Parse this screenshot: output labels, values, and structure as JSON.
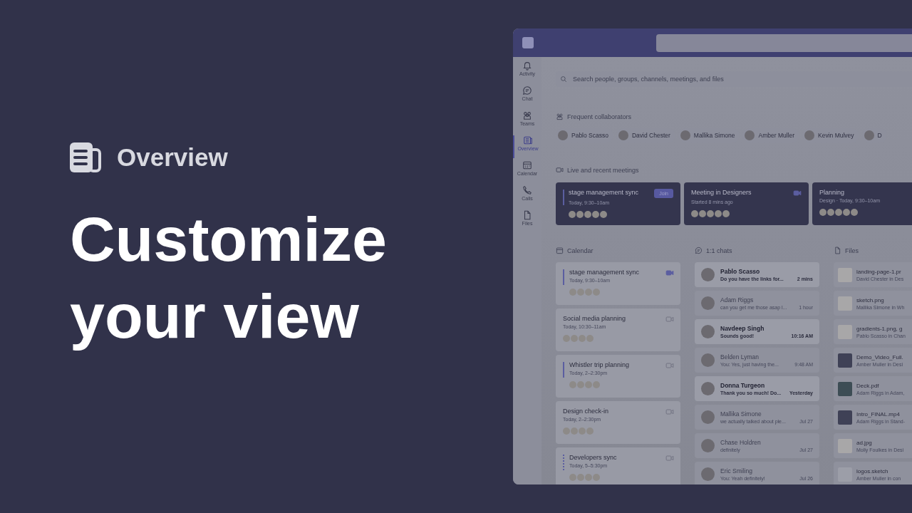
{
  "intro": {
    "section_title": "Overview",
    "headline": "Customize your view"
  },
  "app": {
    "rail": [
      {
        "label": "Activity",
        "selected": false
      },
      {
        "label": "Chat",
        "selected": false
      },
      {
        "label": "Teams",
        "selected": false
      },
      {
        "label": "Overview",
        "selected": true
      },
      {
        "label": "Calendar",
        "selected": false
      },
      {
        "label": "Calls",
        "selected": false
      },
      {
        "label": "Files",
        "selected": false
      }
    ],
    "search": {
      "placeholder": "Search people, groups, channels, meetings, and files"
    },
    "collaborators": {
      "title": "Frequent collaborators",
      "people": [
        "Pablo Scasso",
        "David Chester",
        "Mallika Simone",
        "Amber Muller",
        "Kevin Mulvey",
        "D"
      ]
    },
    "meetings": {
      "title": "Live and recent meetings",
      "items": [
        {
          "kind": "join",
          "title": "stage management sync",
          "time": "Today, 9:30–10am",
          "action": "Join"
        },
        {
          "kind": "video",
          "title": "Meeting in Designers",
          "time": "Started 8 mins ago"
        },
        {
          "kind": "plain",
          "title": "Planning",
          "time": "Design · Today, 9:30–10am"
        }
      ]
    },
    "calendar": {
      "title": "Calendar",
      "items": [
        {
          "title": "stage management sync",
          "time": "Today, 9:30–10am",
          "kind": "solid",
          "camera_active": true
        },
        {
          "title": "Social media planning",
          "time": "Today, 10:30–11am",
          "kind": "plain",
          "camera_active": false
        },
        {
          "title": "Whistler trip planning",
          "time": "Today, 2–2:30pm",
          "kind": "solid",
          "camera_active": false
        },
        {
          "title": "Design check-in",
          "time": "Today, 2–2:30pm",
          "kind": "plain",
          "camera_active": false
        },
        {
          "title": "Developers sync",
          "time": "Today, 5–5:30pm",
          "kind": "dotted",
          "camera_active": false
        }
      ]
    },
    "chats": {
      "title": "1:1 chats",
      "items": [
        {
          "name": "Pablo Scasso",
          "message": "Do you have the links for...",
          "time": "2 mins",
          "unread": true
        },
        {
          "name": "Adam Riggs",
          "message": "can you get me those asap l...",
          "time": "1 hour",
          "unread": false
        },
        {
          "name": "Navdeep Singh",
          "message": "Sounds good!",
          "time": "10:16 AM",
          "unread": true
        },
        {
          "name": "Belden Lyman",
          "message": "You: Yes, just having the...",
          "time": "9:48 AM",
          "unread": false
        },
        {
          "name": "Donna Turgeon",
          "message": "Thank you so much! Do...",
          "time": "Yesterday",
          "unread": true
        },
        {
          "name": "Mallika Simone",
          "message": "we actually talked about ple...",
          "time": "Jul 27",
          "unread": false
        },
        {
          "name": "Chase Holdren",
          "message": "definitely",
          "time": "Jul 27",
          "unread": false
        },
        {
          "name": "Eric Smiling",
          "message": "You: Yeah definitely!",
          "time": "Jul 26",
          "unread": false
        }
      ]
    },
    "files": {
      "title": "Files",
      "items": [
        {
          "kind": "image",
          "name": "landing-page-1.pr",
          "detail": "David Chester in Des"
        },
        {
          "kind": "image",
          "name": "sketch.png",
          "detail": "Mallika Simone in Wh"
        },
        {
          "kind": "image",
          "name": "gradients-1.png, g",
          "detail": "Pablo Scasso in Chan"
        },
        {
          "kind": "video",
          "name": "Demo_Video_Full.",
          "detail": "Amber Muller in Desi"
        },
        {
          "kind": "pdf",
          "name": "Deck.pdf",
          "detail": "Adam Riggs in Adam,"
        },
        {
          "kind": "video",
          "name": "Intro_FINAL.mp4",
          "detail": "Adam Riggs in Stand-"
        },
        {
          "kind": "image",
          "name": "ad.jpg",
          "detail": "Molly Foulkes in Desi"
        },
        {
          "kind": "sketch",
          "name": "logos.sketch",
          "detail": "Amber Muller in con"
        }
      ]
    }
  }
}
